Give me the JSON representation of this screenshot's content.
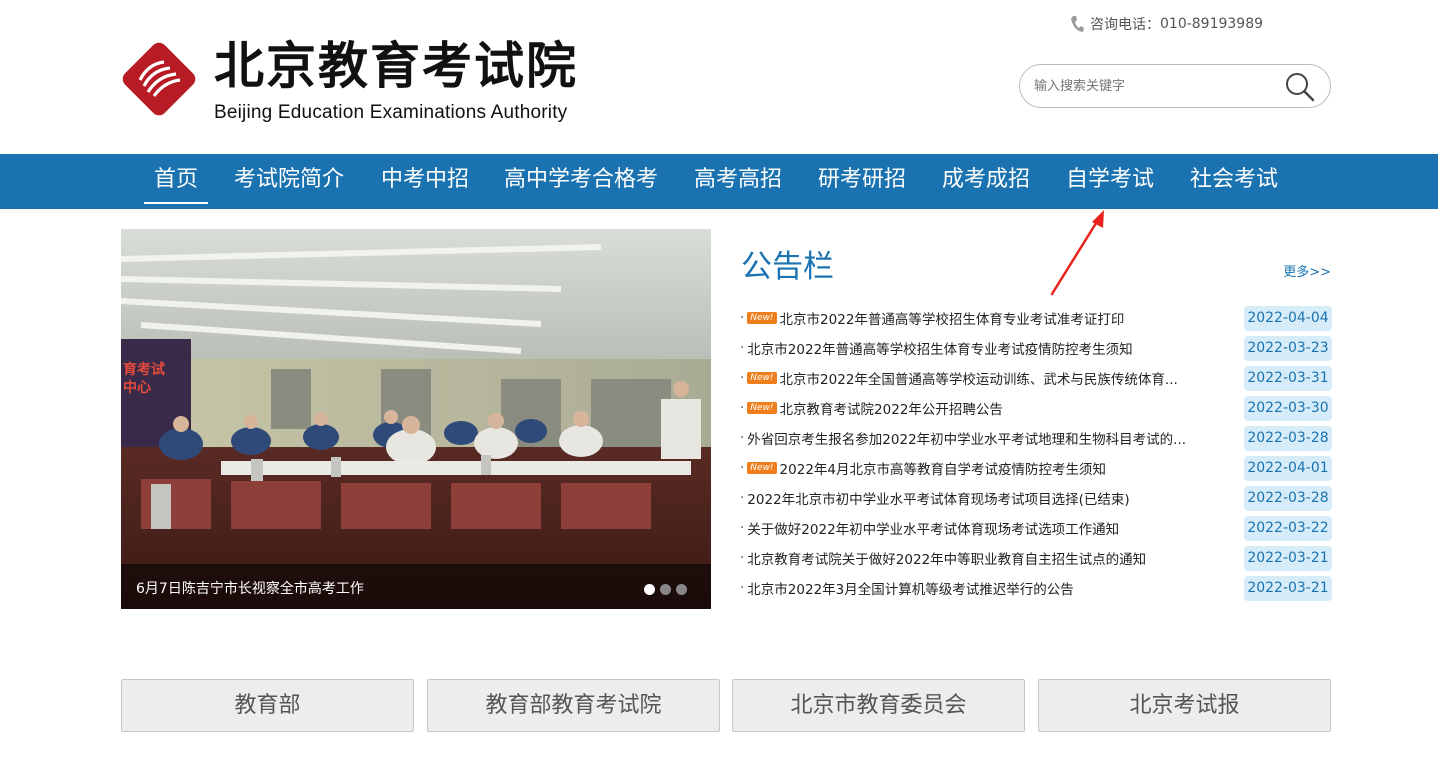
{
  "header": {
    "logo_cn": "北京教育考试院",
    "logo_en": "Beijing Education Examinations Authority",
    "hotline_label": "咨询电话：",
    "hotline_number": "010-89193989",
    "search_placeholder": "输入搜索关键字"
  },
  "nav": {
    "items": [
      {
        "label": "首页",
        "active": true
      },
      {
        "label": "考试院简介"
      },
      {
        "label": "中考中招"
      },
      {
        "label": "高中学考合格考"
      },
      {
        "label": "高考高招"
      },
      {
        "label": "研考研招"
      },
      {
        "label": "成考成招"
      },
      {
        "label": "自学考试"
      },
      {
        "label": "社会考试"
      }
    ]
  },
  "slider": {
    "photo_sign_line1": "育考试",
    "photo_sign_line2": "中心",
    "caption": "6月7日陈吉宁市长视察全市高考工作",
    "slide_count": 3,
    "active_slide": 1
  },
  "notices": {
    "title": "公告栏",
    "more": "更多>>",
    "bullet": "·",
    "new_label": "New!",
    "items": [
      {
        "text": "北京市2022年普通高等学校招生体育专业考试准考证打印",
        "date": "2022-04-04",
        "new": true
      },
      {
        "text": "北京市2022年普通高等学校招生体育专业考试疫情防控考生须知",
        "date": "2022-03-23",
        "new": false
      },
      {
        "text": "北京市2022年全国普通高等学校运动训练、武术与民族传统体育...",
        "date": "2022-03-31",
        "new": true
      },
      {
        "text": "北京教育考试院2022年公开招聘公告",
        "date": "2022-03-30",
        "new": true
      },
      {
        "text": "外省回京考生报名参加2022年初中学业水平考试地理和生物科目考试的...",
        "date": "2022-03-28",
        "new": false
      },
      {
        "text": "2022年4月北京市高等教育自学考试疫情防控考生须知",
        "date": "2022-04-01",
        "new": true
      },
      {
        "text": "2022年北京市初中学业水平考试体育现场考试项目选择(已结束)",
        "date": "2022-03-28",
        "new": false
      },
      {
        "text": "关于做好2022年初中学业水平考试体育现场考试选项工作通知",
        "date": "2022-03-22",
        "new": false
      },
      {
        "text": "北京教育考试院关于做好2022年中等职业教育自主招生试点的通知",
        "date": "2022-03-21",
        "new": false
      },
      {
        "text": "北京市2022年3月全国计算机等级考试推迟举行的公告",
        "date": "2022-03-21",
        "new": false
      }
    ]
  },
  "links": [
    {
      "label": "教育部"
    },
    {
      "label": "教育部教育考试院"
    },
    {
      "label": "北京市教育委员会"
    },
    {
      "label": "北京考试报"
    }
  ],
  "colors": {
    "brand_blue": "#1a73b0",
    "logo_red": "#b71c24",
    "new_badge": "#ee7d1c",
    "date_bg": "#d7ecf9",
    "annotation_red": "#e8241c"
  },
  "icons": {
    "logo": "logo-emblem-icon",
    "phone": "phone-icon",
    "search": "search-icon",
    "annotation": "red-arrow-icon"
  }
}
